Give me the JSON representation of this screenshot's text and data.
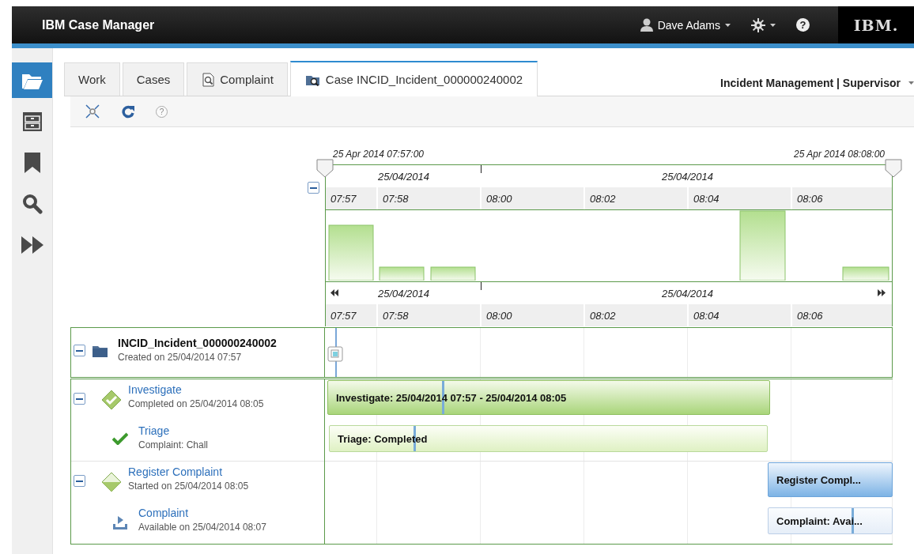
{
  "header": {
    "title": "IBM Case Manager",
    "user": "Dave Adams",
    "help": "?",
    "logo": "IBM."
  },
  "sidebar": {
    "items": [
      {
        "selected": true
      },
      {
        "selected": false
      },
      {
        "selected": false
      },
      {
        "selected": false
      },
      {
        "selected": false
      }
    ]
  },
  "tabs": [
    {
      "label": "Work",
      "kind": "plain",
      "selected": false
    },
    {
      "label": "Cases",
      "kind": "plain",
      "selected": false
    },
    {
      "label": "Complaint",
      "kind": "search",
      "selected": false
    },
    {
      "label": "Case INCID_Incident_000000240002",
      "kind": "case",
      "selected": true
    }
  ],
  "role_menu": {
    "label": "Incident Management | Supervisor"
  },
  "toolbar": {
    "help": "?"
  },
  "timeline": {
    "range_start": "25 Apr 2014 07:57:00",
    "range_end": "25 Apr 2014 08:08:00",
    "histogram_expanded": true,
    "scales": [
      {
        "dates": [
          "25/04/2014",
          "25/04/2014"
        ],
        "times": [
          "07:57",
          "07:58",
          "08:00",
          "08:02",
          "08:04",
          "08:06"
        ]
      },
      {
        "dates": [
          "25/04/2014",
          "25/04/2014"
        ],
        "times": [
          "07:57",
          "07:58",
          "08:00",
          "08:02",
          "08:04",
          "08:06"
        ]
      }
    ]
  },
  "case": {
    "title": "INCID_Incident_000000240002",
    "subtitle": "Created on 25/04/2014 07:57",
    "expanded": true,
    "stages": [
      {
        "title": "Investigate",
        "subtitle": "Completed on 25/04/2014 08:05",
        "kind": "completed",
        "expanded": true,
        "bar": "Investigate: 25/04/2014 07:57 - 25/04/2014 08:05",
        "tasks": [
          {
            "title": "Triage",
            "subtitle": "Complaint: Chall",
            "kind": "completed",
            "bar": "Triage: Completed"
          }
        ]
      },
      {
        "title": "Register Complaint",
        "subtitle": "Started on 25/04/2014 08:05",
        "kind": "started",
        "expanded": true,
        "bar": "Register Compl...",
        "tasks": [
          {
            "title": "Complaint",
            "subtitle": "Available on 25/04/2014 08:07",
            "kind": "available",
            "bar": "Complaint: Avai..."
          }
        ]
      }
    ]
  }
}
